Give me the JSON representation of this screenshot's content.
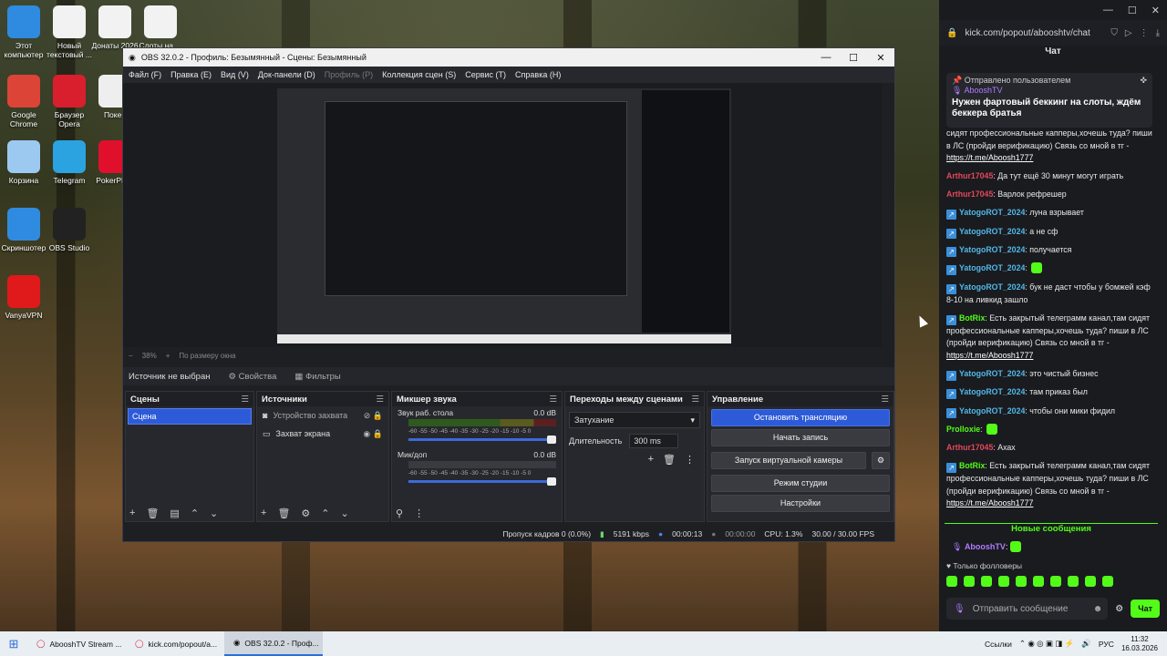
{
  "desktop": {
    "icons": [
      {
        "label": "Этот компьютер",
        "color": "#2f8be0"
      },
      {
        "label": "Новый текстовый ...",
        "color": "#f2f2f2"
      },
      {
        "label": "Донаты 2026",
        "color": "#f2f2f2"
      },
      {
        "label": "Слоты на ...",
        "color": "#f2f2f2"
      },
      {
        "label": "Google Chrome",
        "color": "#db4437"
      },
      {
        "label": "Браузер Opera",
        "color": "#d91e2e"
      },
      {
        "label": "Покер",
        "color": "#eeeeee"
      },
      {
        "label": "Корзина",
        "color": "#9cc9f0"
      },
      {
        "label": "Telegram",
        "color": "#2aa3e0"
      },
      {
        "label": "PokerPla...",
        "color": "#e0102d"
      },
      {
        "label": "Скриншотер",
        "color": "#2f8be0"
      },
      {
        "label": "OBS Studio",
        "color": "#222222"
      },
      {
        "label": "VanyaVPN",
        "color": "#e01a1a"
      }
    ]
  },
  "obs": {
    "title": "OBS 32.0.2 - Профиль: Безымянный - Сцены: Безымянный",
    "menu": [
      "Файл (F)",
      "Правка (E)",
      "Вид (V)",
      "Док-панели (D)",
      "Профиль (P)",
      "Коллекция сцен (S)",
      "Сервис (T)",
      "Справка (H)"
    ],
    "zoom": {
      "percent": "38%",
      "mode": "По размеру окна"
    },
    "source_bar": {
      "none_selected": "Источник не выбран",
      "properties": "Свойства",
      "filters": "Фильтры"
    },
    "docks": {
      "scenes": {
        "title": "Сцены",
        "items": [
          "Сцена"
        ]
      },
      "sources": {
        "title": "Источники",
        "items": [
          "Устройство захвата",
          "Захват экрана"
        ]
      },
      "mixer": {
        "title": "Микшер звука",
        "channels": [
          {
            "name": "Звук раб. стола",
            "db": "0.0 dB"
          },
          {
            "name": "Мик/доп",
            "db": "0.0 dB"
          }
        ],
        "scale": "-60 -55 -50 -45 -40 -35 -30 -25 -20 -15 -10 -5 0"
      },
      "transitions": {
        "title": "Переходы между сценами",
        "selected": "Затухание",
        "duration_label": "Длительность",
        "duration_value": "300 ms"
      },
      "controls": {
        "title": "Управление",
        "stop_stream": "Остановить трансляцию",
        "start_record": "Начать запись",
        "virtual_cam": "Запуск виртуальной камеры",
        "studio_mode": "Режим студии",
        "settings": "Настройки"
      }
    },
    "status": {
      "dropped": "Пропуск кадров 0 (0.0%)",
      "bitrate": "5191 kbps",
      "stream_time": "00:00:13",
      "rec_time": "00:00:00",
      "cpu": "CPU: 1.3%",
      "fps": "30.00 / 30.00 FPS"
    }
  },
  "chat": {
    "url": "kick.com/popout/abooshtv/chat",
    "title": "Чат",
    "pinned": {
      "label": "Отправлено пользователем",
      "user": "AbooshTV",
      "text": "Нужен фартовый беккинг на слоты, ждём беккера братья"
    },
    "messages": [
      {
        "user": "",
        "text": "сидят профессиональные капперы,хочешь туда? пиши в ЛС (пройди верификацию) Связь со мной в тг - ",
        "link": "https://t.me/Aboosh1777",
        "cls": "u-green"
      },
      {
        "user": "Arthur17045",
        "text": ": Да тут ещё 30 минут могут играть",
        "link": "",
        "cls": "u-red"
      },
      {
        "user": "Arthur17045",
        "text": ": Варлок рефрешер",
        "link": "",
        "cls": "u-red"
      },
      {
        "user": "YatogoROT_2024",
        "text": ": луна взрывает",
        "link": "",
        "cls": "u-blue"
      },
      {
        "user": "YatogoROT_2024",
        "text": ": а не сф",
        "link": "",
        "cls": "u-blue"
      },
      {
        "user": "YatogoROT_2024",
        "text": ": получается",
        "link": "",
        "cls": "u-blue"
      },
      {
        "user": "YatogoROT_2024",
        "text": ":",
        "link": "",
        "cls": "u-blue"
      },
      {
        "user": "YatogoROT_2024",
        "text": ": бук не даст чтобы у бомжей кэф 8-10 на ливкид зашло",
        "link": "",
        "cls": "u-blue"
      },
      {
        "user": "BotRix",
        "text": ": Есть закрытый телеграмм канал,там сидят профессиональные капперы,хочешь туда? пиши в ЛС (пройди верификацию) Связь со мной в тг - ",
        "link": "https://t.me/Aboosh1777",
        "cls": "u-green"
      },
      {
        "user": "YatogoROT_2024",
        "text": ": это чистый бизнес",
        "link": "",
        "cls": "u-blue"
      },
      {
        "user": "YatogoROT_2024",
        "text": ": там приказ был",
        "link": "",
        "cls": "u-blue"
      },
      {
        "user": "YatogoROT_2024",
        "text": ": чтобы они мики фидил",
        "link": "",
        "cls": "u-blue"
      },
      {
        "user": "Prolloxie",
        "text": ":",
        "link": "",
        "cls": "u-green"
      },
      {
        "user": "Arthur17045",
        "text": ": Ахах",
        "link": "",
        "cls": "u-red"
      },
      {
        "user": "BotRix",
        "text": ": Есть закрытый телеграмм канал,там сидят профессиональные капперы,хочешь туда? пиши в ЛС (пройди верификацию) Связь со мной в тг - ",
        "link": "https://t.me/Aboosh1777",
        "cls": "u-green"
      }
    ],
    "new_messages": "Новые сообщения",
    "last_user": "AbooshTV",
    "followers_only": "Только фолловеры",
    "input_placeholder": "Отправить сообщение",
    "send": "Чат"
  },
  "taskbar": {
    "tasks": [
      "AbooshTV Stream ...",
      "kick.com/popout/a...",
      "OBS 32.0.2 - Проф..."
    ],
    "links": "Ссылки",
    "lang": "РУС",
    "time": "11:32",
    "date": "16.03.2026"
  }
}
